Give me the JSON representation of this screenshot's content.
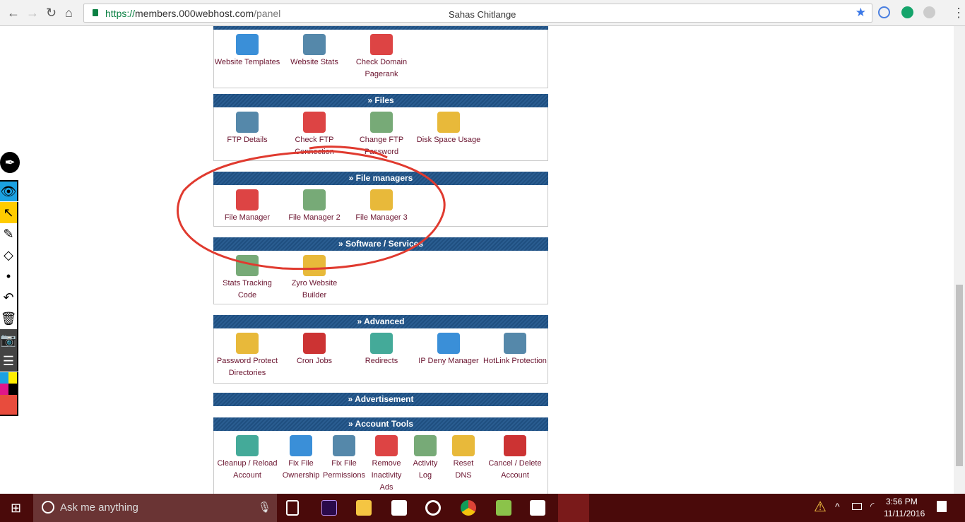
{
  "browser": {
    "url_scheme": "https://",
    "url_host": "members.000webhost.com",
    "url_path": "/panel",
    "profile": "Sahas Chitlange"
  },
  "sections": [
    {
      "title": "",
      "items": [
        "Website Templates",
        "Website Stats",
        "Check Domain Pagerank"
      ]
    },
    {
      "title": "» Files",
      "items": [
        "FTP Details",
        "Check FTP Connection",
        "Change FTP Password",
        "Disk Space Usage"
      ]
    },
    {
      "title": "» File managers",
      "items": [
        "File Manager",
        "File Manager 2",
        "File Manager 3"
      ]
    },
    {
      "title": "» Software / Services",
      "items": [
        "Stats Tracking Code",
        "Zyro Website Builder"
      ]
    },
    {
      "title": "» Advanced",
      "items": [
        "Password Protect Directories",
        "Cron Jobs",
        "Redirects",
        "IP Deny Manager",
        "HotLink Protection"
      ]
    },
    {
      "title": "» Advertisement",
      "items": []
    },
    {
      "title": "» Account Tools",
      "items": [
        "Cleanup / Reload Account",
        "Fix File Ownership",
        "Fix File Permissions",
        "Remove Inactivity Ads",
        "Activity Log",
        "Reset DNS",
        "Cancel / Delete Account"
      ]
    }
  ],
  "taskbar": {
    "search_placeholder": "Ask me anything",
    "time": "3:56 PM",
    "date": "11/11/2016"
  },
  "colors": {
    "header": "#1f4f80",
    "link": "#6b1530",
    "annotation": "#e03a2f"
  }
}
